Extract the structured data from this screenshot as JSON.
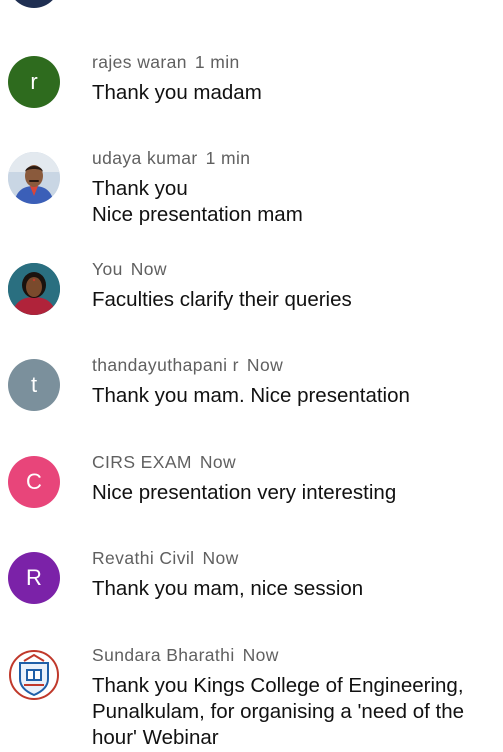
{
  "messages": [
    {
      "author": "rajes waran",
      "time": "1 min",
      "text": "Thank you madam",
      "avatar": {
        "type": "letter",
        "letter": "r",
        "color": "#2e6b1e"
      }
    },
    {
      "author": "udaya kumar",
      "time": "1 min",
      "text": "Thank you\nNice presentation mam",
      "avatar": {
        "type": "photo",
        "icon": "man-photo-avatar"
      }
    },
    {
      "author": "You",
      "time": "Now",
      "text": "Faculties clarify their queries",
      "avatar": {
        "type": "photo",
        "icon": "woman-photo-avatar"
      }
    },
    {
      "author": "thandayuthapani r",
      "time": "Now",
      "text": "Thank you mam. Nice presentation",
      "avatar": {
        "type": "letter",
        "letter": "t",
        "color": "#7b909c"
      }
    },
    {
      "author": "CIRS EXAM",
      "time": "Now",
      "text": "Nice presentation very interesting",
      "avatar": {
        "type": "letter",
        "letter": "C",
        "color": "#e8457a"
      }
    },
    {
      "author": "Revathi Civil",
      "time": "Now",
      "text": "Thank you mam, nice session",
      "avatar": {
        "type": "letter",
        "letter": "R",
        "color": "#7b22a8"
      }
    },
    {
      "author": "Sundara Bharathi",
      "time": "Now",
      "text": "Thank you Kings College of Engineering, Punalkulam, for organising a 'need of the hour' Webinar",
      "avatar": {
        "type": "logo",
        "icon": "college-crest-logo"
      }
    }
  ]
}
